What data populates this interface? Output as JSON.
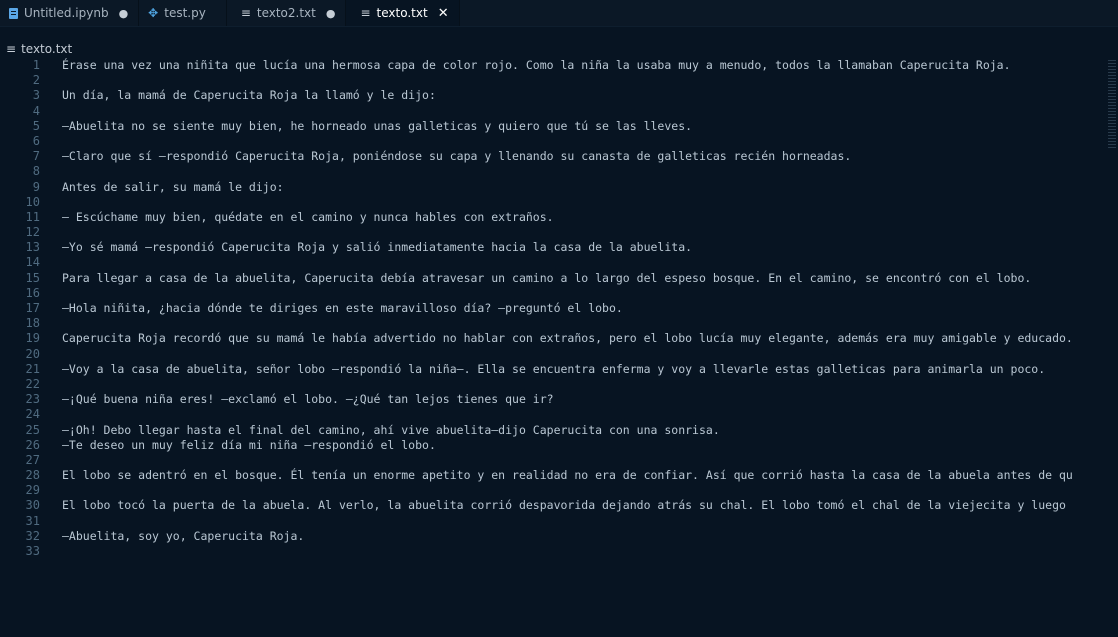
{
  "tabs": [
    {
      "label": "Untitled.ipynb",
      "icon": "notebook-icon",
      "status": "●"
    },
    {
      "label": "test.py",
      "icon": "python-icon",
      "status": ""
    },
    {
      "label": "texto2.txt",
      "icon": "text-file-icon",
      "status": "●"
    },
    {
      "label": "texto.txt",
      "icon": "text-file-icon",
      "status": "✕"
    }
  ],
  "breadcrumb": {
    "file": "texto.txt"
  },
  "lines": [
    {
      "n": "1",
      "t": "Érase una vez una niñita que lucía una hermosa capa de color rojo. Como la niña la usaba muy a menudo, todos la llamaban Caperucita Roja."
    },
    {
      "n": "2",
      "t": ""
    },
    {
      "n": "3",
      "t": "Un día, la mamá de Caperucita Roja la llamó y le dijo:"
    },
    {
      "n": "4",
      "t": ""
    },
    {
      "n": "5",
      "t": "—Abuelita no se siente muy bien, he horneado unas galleticas y quiero que tú se las lleves."
    },
    {
      "n": "6",
      "t": ""
    },
    {
      "n": "7",
      "t": "—Claro que sí —respondió Caperucita Roja, poniéndose su capa y llenando su canasta de galleticas recién horneadas."
    },
    {
      "n": "8",
      "t": ""
    },
    {
      "n": "9",
      "t": "Antes de salir, su mamá le dijo:"
    },
    {
      "n": "10",
      "t": ""
    },
    {
      "n": "11",
      "t": "— Escúchame muy bien, quédate en el camino y nunca hables con extraños."
    },
    {
      "n": "12",
      "t": ""
    },
    {
      "n": "13",
      "t": "—Yo sé mamá —respondió Caperucita Roja y salió inmediatamente hacia la casa de la abuelita."
    },
    {
      "n": "14",
      "t": ""
    },
    {
      "n": "15",
      "t": "Para llegar a casa de la abuelita, Caperucita debía atravesar un camino a lo largo del espeso bosque. En el camino, se encontró con el lobo."
    },
    {
      "n": "16",
      "t": ""
    },
    {
      "n": "17",
      "t": "—Hola niñita, ¿hacia dónde te diriges en este maravilloso día? —preguntó el lobo."
    },
    {
      "n": "18",
      "t": ""
    },
    {
      "n": "19",
      "t": "Caperucita Roja recordó que su mamá le había advertido no hablar con extraños, pero el lobo lucía muy elegante, además era muy amigable y educado."
    },
    {
      "n": "20",
      "t": ""
    },
    {
      "n": "21",
      "t": "—Voy a la casa de abuelita, señor lobo —respondió la niña—. Ella se encuentra enferma y voy a llevarle estas galleticas para animarla un poco."
    },
    {
      "n": "22",
      "t": ""
    },
    {
      "n": "23",
      "t": "—¡Qué buena niña eres! —exclamó el lobo. —¿Qué tan lejos tienes que ir?"
    },
    {
      "n": "24",
      "t": ""
    },
    {
      "n": "25",
      "t": "—¡Oh! Debo llegar hasta el final del camino, ahí vive abuelita—dijo Caperucita con una sonrisa."
    },
    {
      "n": "26",
      "t": "—Te deseo un muy feliz día mi niña —respondió el lobo."
    },
    {
      "n": "27",
      "t": ""
    },
    {
      "n": "28",
      "t": "El lobo se adentró en el bosque. Él tenía un enorme apetito y en realidad no era de confiar. Así que corrió hasta la casa de la abuela antes de qu"
    },
    {
      "n": "29",
      "t": ""
    },
    {
      "n": "30",
      "t": "El lobo tocó la puerta de la abuela. Al verlo, la abuelita corrió despavorida dejando atrás su chal. El lobo tomó el chal de la viejecita y luego"
    },
    {
      "n": "31",
      "t": ""
    },
    {
      "n": "32",
      "t": "—Abuelita, soy yo, Caperucita Roja."
    },
    {
      "n": "33",
      "t": ""
    }
  ]
}
